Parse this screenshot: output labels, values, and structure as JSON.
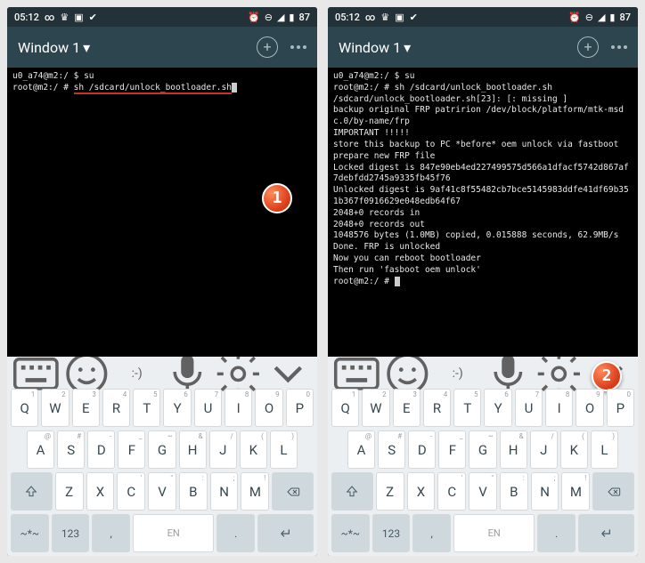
{
  "status": {
    "time": "05:12",
    "battery": "87"
  },
  "appbar": {
    "window_title": "Window 1"
  },
  "left_terminal": {
    "line1": "u0_a74@m2:/ $ su",
    "prompt": "root@m2:/ # ",
    "cmd": "sh /sdcard/unlock_bootloader.sh"
  },
  "right_terminal": {
    "line1": "u0_a74@m2:/ $ su",
    "line2": "root@m2:/ # sh /sdcard/unlock_bootloader.sh",
    "line3": "/sdcard/unlock_bootloader.sh[23]: [: missing ]",
    "line4": "backup original FRP patririon /dev/block/platform/mtk-msdc.0/by-name/frp",
    "line5": "IMPORTANT !!!!!",
    "line6": "store this backup to PC *before* oem unlock via fastboot",
    "line7": "prepare new FRP file",
    "line8": "Locked digest is 847e90eb4ed227499575d566a1dfacf5742d867af7debfdd2745a9335fb45f76",
    "line9": "Unlocked digest is 9af41c8f55482cb7bce5145983ddfe41df69b351b367f0916629e048edb64f67",
    "line10": "2048+0 records in",
    "line11": "2048+0 records out",
    "line12": "1048576 bytes (1.0MB) copied, 0.015888 seconds, 62.9MB/s",
    "line13": "Done. FRP is unlocked",
    "line14": "Now you can reboot bootloader",
    "line15": "Then run 'fasboot oem unlock'",
    "line16": "root@m2:/ # "
  },
  "keyboard": {
    "row1": [
      {
        "main": "Q",
        "alt": "1"
      },
      {
        "main": "W",
        "alt": "2"
      },
      {
        "main": "E",
        "alt": "3"
      },
      {
        "main": "R",
        "alt": "4"
      },
      {
        "main": "T",
        "alt": "5"
      },
      {
        "main": "Y",
        "alt": "6"
      },
      {
        "main": "U",
        "alt": "7"
      },
      {
        "main": "I",
        "alt": "8"
      },
      {
        "main": "O",
        "alt": "9"
      },
      {
        "main": "P",
        "alt": "0"
      }
    ],
    "row2": [
      {
        "main": "A",
        "alt": "@"
      },
      {
        "main": "S",
        "alt": "#"
      },
      {
        "main": "D",
        "alt": "-"
      },
      {
        "main": "F",
        "alt": "_"
      },
      {
        "main": "G",
        "alt": "~"
      },
      {
        "main": "H",
        "alt": "&"
      },
      {
        "main": "J",
        "alt": "/"
      },
      {
        "main": "K",
        "alt": "("
      },
      {
        "main": "L",
        "alt": ")"
      }
    ],
    "row3": [
      {
        "main": "Z",
        "alt": ""
      },
      {
        "main": "X",
        "alt": ""
      },
      {
        "main": "C",
        "alt": "'"
      },
      {
        "main": "V",
        "alt": "\""
      },
      {
        "main": "B",
        "alt": ":"
      },
      {
        "main": "N",
        "alt": ";"
      },
      {
        "main": "M",
        "alt": "!"
      }
    ],
    "row4": {
      "sym": "~*~",
      "num": "123",
      "comma": ",",
      "lang": "EN",
      "period": "."
    }
  },
  "badges": {
    "b1": "1",
    "b2": "2"
  }
}
